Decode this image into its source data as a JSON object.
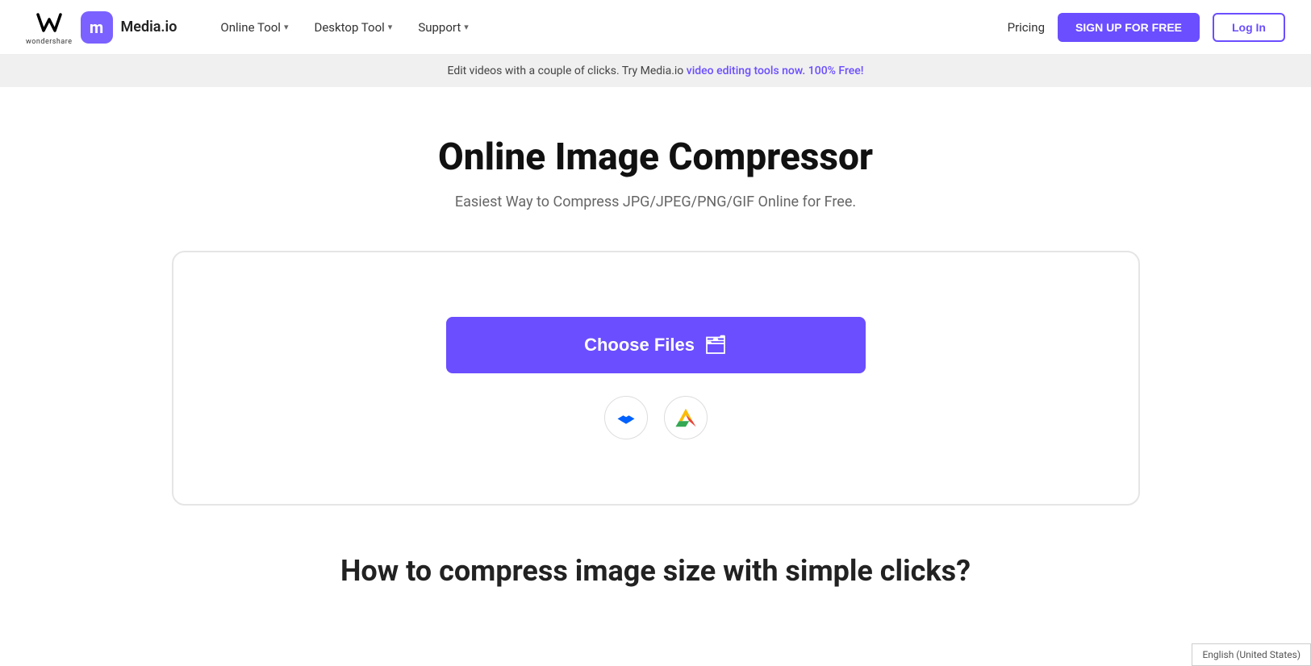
{
  "brand": {
    "wondershare_label": "wondershare",
    "media_letter": "m",
    "media_name": "Media.io"
  },
  "nav": {
    "online_tool": "Online Tool",
    "desktop_tool": "Desktop Tool",
    "support": "Support"
  },
  "nav_right": {
    "pricing": "Pricing",
    "signup": "SIGN UP FOR FREE",
    "login": "Log In"
  },
  "banner": {
    "text": "Edit videos with a couple of clicks. Try Media.io ",
    "link_text": "video editing tools now. 100% Free!"
  },
  "hero": {
    "title": "Online Image Compressor",
    "subtitle": "Easiest Way to Compress JPG/JPEG/PNG/GIF Online for Free."
  },
  "upload": {
    "choose_files": "Choose Files"
  },
  "bottom": {
    "heading": "How to compress image size with simple clicks?"
  },
  "lang": {
    "label": "English (United States)"
  }
}
